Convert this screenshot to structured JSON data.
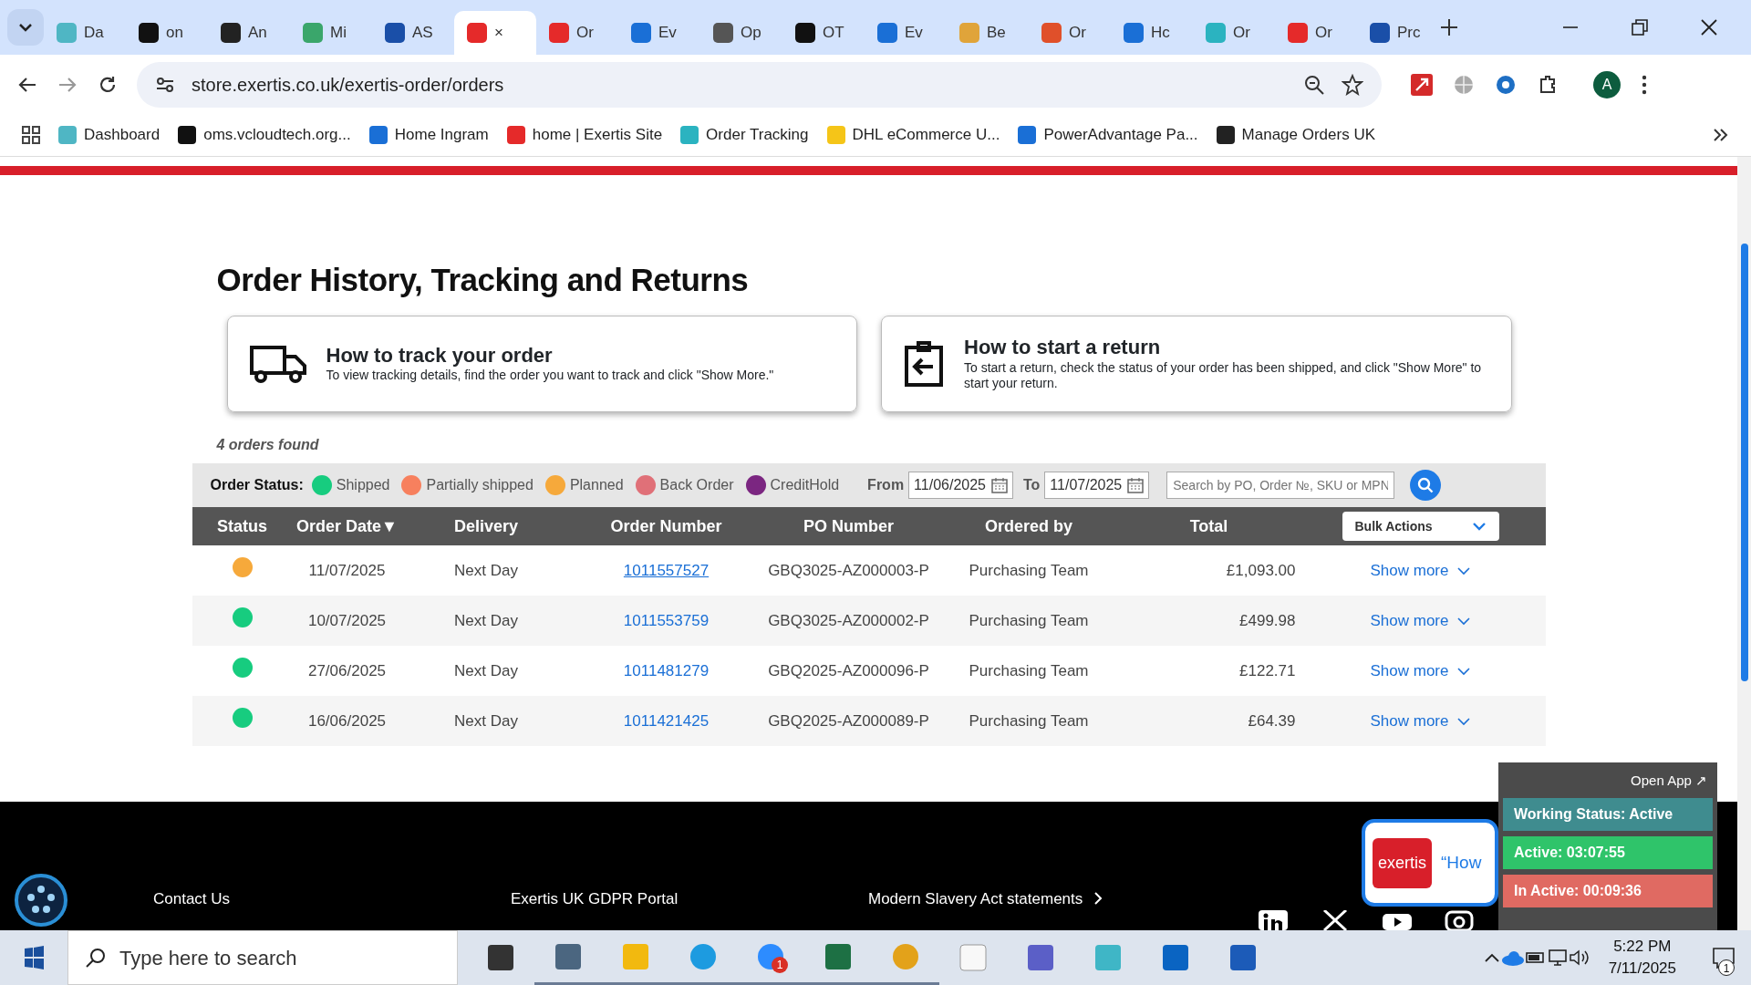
{
  "browser": {
    "tabs": [
      {
        "label": "Da",
        "selected": false
      },
      {
        "label": "on",
        "selected": false
      },
      {
        "label": "An",
        "selected": false
      },
      {
        "label": "Mi",
        "selected": false
      },
      {
        "label": "AS",
        "selected": false
      },
      {
        "label": "×",
        "selected": true
      },
      {
        "label": "Or",
        "selected": false
      },
      {
        "label": "Ev",
        "selected": false
      },
      {
        "label": "Op",
        "selected": false
      },
      {
        "label": "OT",
        "selected": false
      },
      {
        "label": "Ev",
        "selected": false
      },
      {
        "label": "Be",
        "selected": false
      },
      {
        "label": "Or",
        "selected": false
      },
      {
        "label": "Hc",
        "selected": false
      },
      {
        "label": "Or",
        "selected": false
      },
      {
        "label": "Or",
        "selected": false
      },
      {
        "label": "Prc",
        "selected": false
      }
    ],
    "address": "store.exertis.co.uk/exertis-order/orders",
    "profile": "A",
    "bookmarks": [
      "Dashboard",
      "oms.vcloudtech.org...",
      "Home Ingram",
      "home | Exertis Site",
      "Order Tracking",
      "DHL eCommerce U...",
      "PowerAdvantage Pa...",
      "Manage Orders UK"
    ]
  },
  "page": {
    "title": "Order History, Tracking and Returns",
    "help_cards": [
      {
        "kind": "track",
        "title": "How to track your order",
        "text": "To view tracking details, find the order you want to track and click \"Show More.\""
      },
      {
        "kind": "return",
        "title": "How to start a return",
        "text": "To start a return, check the status of your order has been shipped, and click \"Show More\" to start your return."
      }
    ],
    "result_count": "4 orders found",
    "status_legend": {
      "label": "Order Status:",
      "items": [
        {
          "name": "Shipped",
          "color": "#17cc7f"
        },
        {
          "name": "Partially shipped",
          "color": "#f7805e"
        },
        {
          "name": "Planned",
          "color": "#f6a93b"
        },
        {
          "name": "Back Order",
          "color": "#e07078"
        },
        {
          "name": "CreditHold",
          "color": "#7b2681"
        }
      ]
    },
    "filters": {
      "from_label": "From",
      "from": "11/06/2025",
      "to_label": "To",
      "to": "11/07/2025",
      "search_placeholder": "Search by PO, Order №, SKU or MPN"
    },
    "table": {
      "columns": [
        "Status",
        "Order Date▼",
        "Delivery",
        "Order Number",
        "PO Number",
        "Ordered by",
        "Total"
      ],
      "bulk_actions": "Bulk Actions",
      "rows": [
        {
          "color": "#f6a93b",
          "date": "11/07/2025",
          "delivery": "Next Day",
          "order_number": "1011557527",
          "hovered": true,
          "po_number": "GBQ3025-AZ000003-P",
          "ordered_by": "Purchasing Team",
          "total": "£1,093.00",
          "action": "Show more"
        },
        {
          "color": "#17cc7f",
          "date": "10/07/2025",
          "delivery": "Next Day",
          "order_number": "1011553759",
          "hovered": false,
          "po_number": "GBQ3025-AZ000002-P",
          "ordered_by": "Purchasing Team",
          "total": "£499.98",
          "action": "Show more"
        },
        {
          "color": "#17cc7f",
          "date": "27/06/2025",
          "delivery": "Next Day",
          "order_number": "1011481279",
          "hovered": false,
          "po_number": "GBQ2025-AZ000096-P",
          "ordered_by": "Purchasing Team",
          "total": "£122.71",
          "action": "Show more"
        },
        {
          "color": "#17cc7f",
          "date": "16/06/2025",
          "delivery": "Next Day",
          "order_number": "1011421425",
          "hovered": false,
          "po_number": "GBQ2025-AZ000089-P",
          "ordered_by": "Purchasing Team",
          "total": "£64.39",
          "action": "Show more"
        }
      ]
    },
    "footer_links": [
      "Contact Us",
      "Exertis UK GDPR Portal",
      "Modern Slavery Act statements"
    ],
    "chat": {
      "logo": "exertis",
      "prompt": "“How"
    },
    "time_tracker": {
      "open_app": "Open App ↗",
      "working_status": "Working Status: Active",
      "active": "Active: 03:07:55",
      "inactive": "In Active: 00:09:36"
    }
  },
  "taskbar": {
    "search_placeholder": "Type here to search",
    "apps": [
      {
        "kind": "taskview",
        "running": false
      },
      {
        "kind": "calculator",
        "running": true
      },
      {
        "kind": "files",
        "running": true
      },
      {
        "kind": "edge",
        "running": true
      },
      {
        "kind": "zoom",
        "running": true,
        "badge": "1"
      },
      {
        "kind": "excel",
        "running": true
      },
      {
        "kind": "chrome",
        "running": true
      },
      {
        "kind": "notepad",
        "running": false
      },
      {
        "kind": "teams",
        "running": false
      },
      {
        "kind": "app",
        "running": false
      },
      {
        "kind": "outlook",
        "running": false
      },
      {
        "kind": "word",
        "running": false
      }
    ],
    "time": "5:22 PM",
    "date": "7/11/2025",
    "notifications": "1"
  }
}
